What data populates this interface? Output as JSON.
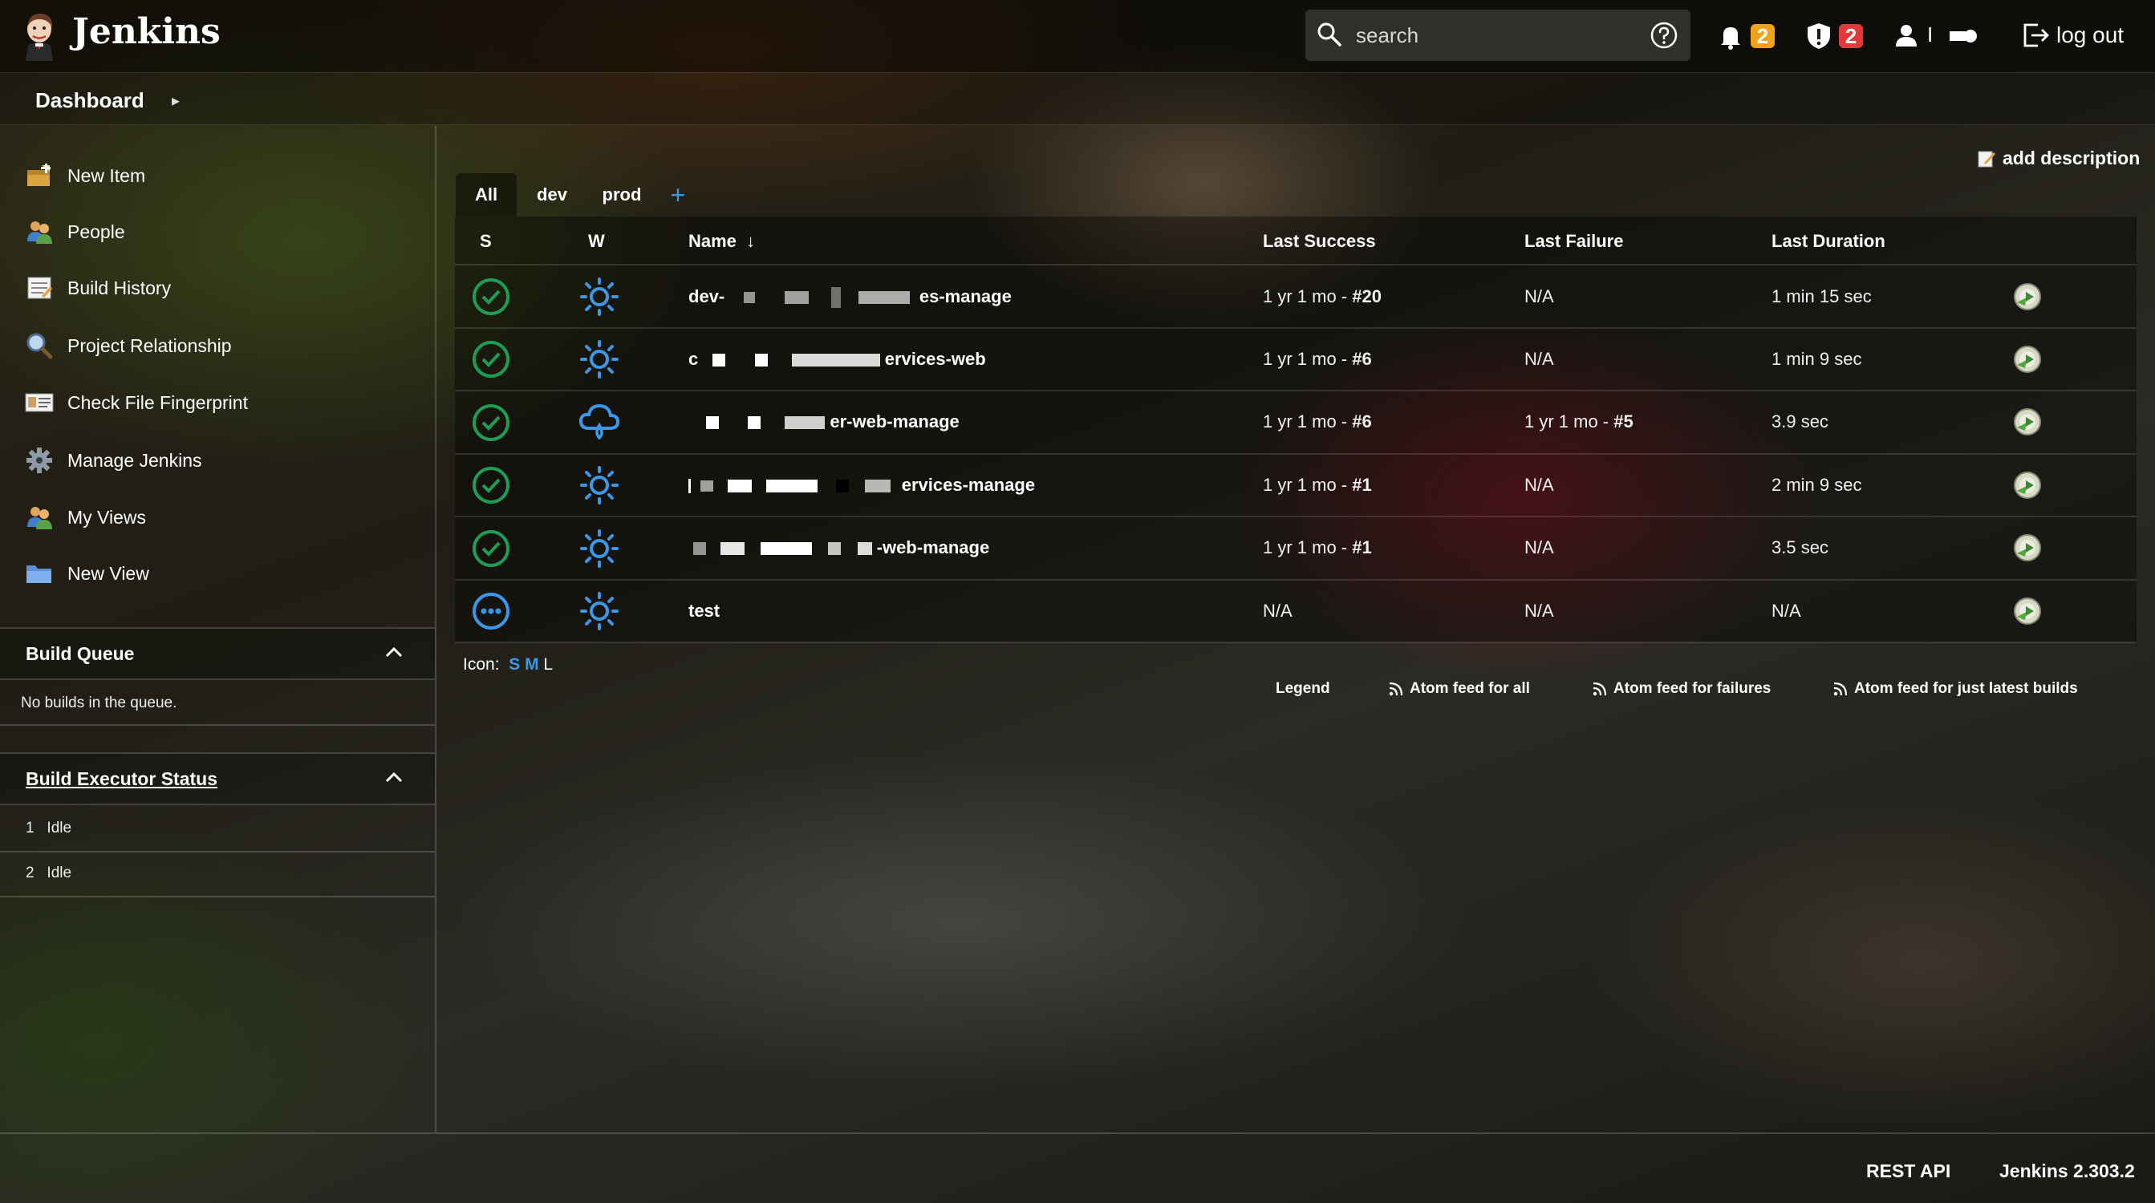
{
  "header": {
    "brand": "Jenkins",
    "search_placeholder": "search",
    "notifications_count": "2",
    "security_count": "2",
    "user_label": "I",
    "logout_label": "log out"
  },
  "breadcrumb": {
    "dashboard": "Dashboard"
  },
  "sidebar": {
    "tasks": [
      {
        "label": "New Item",
        "icon": "new-item-icon"
      },
      {
        "label": "People",
        "icon": "people-icon"
      },
      {
        "label": "Build History",
        "icon": "build-history-icon"
      },
      {
        "label": "Project Relationship",
        "icon": "magnifier-icon"
      },
      {
        "label": "Check File Fingerprint",
        "icon": "fingerprint-icon"
      },
      {
        "label": "Manage Jenkins",
        "icon": "gear-icon"
      },
      {
        "label": "My Views",
        "icon": "people-icon"
      },
      {
        "label": "New View",
        "icon": "folder-icon"
      }
    ],
    "build_queue": {
      "title": "Build Queue",
      "empty_text": "No builds in the queue."
    },
    "executors": {
      "title": "Build Executor Status",
      "items": [
        {
          "num": "1",
          "status": "Idle"
        },
        {
          "num": "2",
          "status": "Idle"
        }
      ]
    }
  },
  "main": {
    "add_description": "add description",
    "tabs": [
      "All",
      "dev",
      "prod"
    ],
    "table": {
      "headers": {
        "status": "S",
        "weather": "W",
        "name": "Name",
        "sort_arrow": "↓",
        "last_success": "Last Success",
        "last_failure": "Last Failure",
        "last_duration": "Last Duration"
      },
      "rows": [
        {
          "status": "success",
          "weather": "sunny",
          "name_prefix": "dev-",
          "name_suffix": "es-manage",
          "success_time": "1 yr 1 mo - ",
          "success_build": "#20",
          "failure_time": "N/A",
          "failure_build": "",
          "duration": "1 min 15 sec"
        },
        {
          "status": "success",
          "weather": "sunny",
          "name_prefix": "c",
          "name_suffix": "ervices-web",
          "success_time": "1 yr 1 mo - ",
          "success_build": "#6",
          "failure_time": "N/A",
          "failure_build": "",
          "duration": "1 min 9 sec"
        },
        {
          "status": "success",
          "weather": "rain",
          "name_prefix": "",
          "name_suffix": "er-web-manage",
          "success_time": "1 yr 1 mo - ",
          "success_build": "#6",
          "failure_time": "1 yr 1 mo - ",
          "failure_build": "#5",
          "duration": "3.9 sec"
        },
        {
          "status": "success",
          "weather": "sunny",
          "name_prefix": "",
          "name_suffix": "ervices-manage",
          "success_time": "1 yr 1 mo - ",
          "success_build": "#1",
          "failure_time": "N/A",
          "failure_build": "",
          "duration": "2 min 9 sec"
        },
        {
          "status": "success",
          "weather": "sunny",
          "name_prefix": "",
          "name_suffix": "-web-manage",
          "success_time": "1 yr 1 mo - ",
          "success_build": "#1",
          "failure_time": "N/A",
          "failure_build": "",
          "duration": "3.5 sec"
        },
        {
          "status": "not-built",
          "weather": "sunny",
          "name_prefix": "test",
          "name_suffix": "",
          "success_time": "N/A",
          "success_build": "",
          "failure_time": "N/A",
          "failure_build": "",
          "duration": "N/A"
        }
      ]
    },
    "icon_size": {
      "label": "Icon:",
      "s": "S",
      "m": "M",
      "l": "L"
    },
    "feeds": {
      "legend": "Legend",
      "all": "Atom feed for all",
      "failures": "Atom feed for failures",
      "latest": "Atom feed for just latest builds"
    }
  },
  "footer": {
    "rest_api": "REST API",
    "version": "Jenkins 2.303.2"
  },
  "colors": {
    "success": "#1e9e55",
    "weather": "#3b98e8",
    "link_blue": "#3b98e8",
    "warning_badge": "#f0a21b",
    "danger_badge": "#e23a3a"
  }
}
